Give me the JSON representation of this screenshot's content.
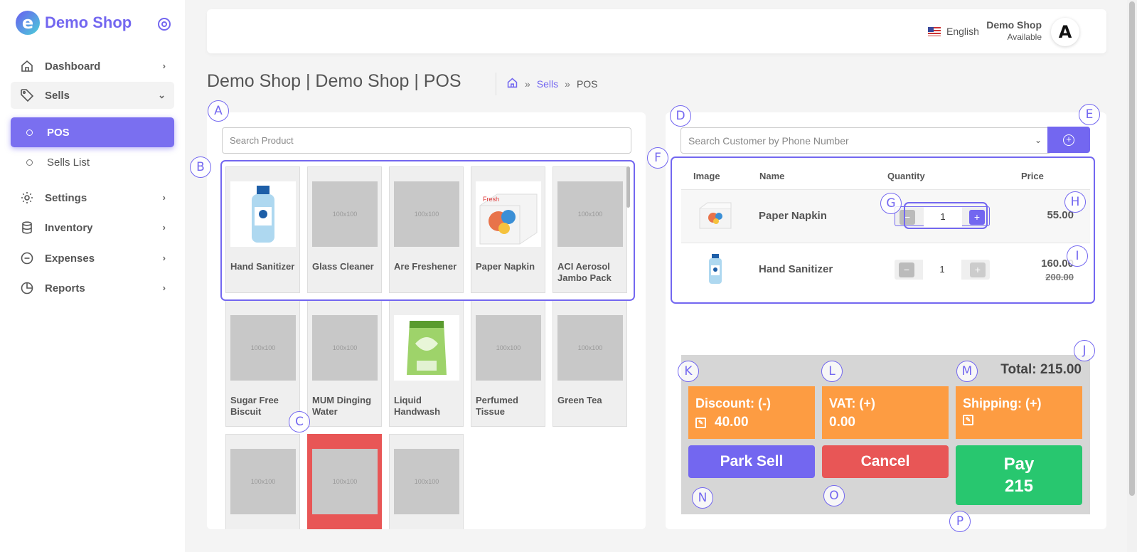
{
  "brand": {
    "name": "Demo Shop",
    "logo_letter": "e"
  },
  "sidebar": {
    "items": [
      {
        "label": "Dashboard",
        "icon": "home-icon"
      },
      {
        "label": "Sells",
        "icon": "tag-icon",
        "open": true,
        "children": [
          {
            "label": "POS",
            "active": true
          },
          {
            "label": "Sells List"
          }
        ]
      },
      {
        "label": "Settings",
        "icon": "gear-icon"
      },
      {
        "label": "Inventory",
        "icon": "database-icon"
      },
      {
        "label": "Expenses",
        "icon": "minus-circle-icon"
      },
      {
        "label": "Reports",
        "icon": "pie-chart-icon"
      }
    ]
  },
  "header": {
    "language": "English",
    "user_name": "Demo Shop",
    "user_status": "Available",
    "avatar_letter": "A"
  },
  "page": {
    "title": "Demo Shop | Demo Shop | POS",
    "breadcrumb": {
      "sep": "»",
      "link": "Sells",
      "current": "POS"
    }
  },
  "products": {
    "search_placeholder": "Search Product",
    "placeholder_thumb": "100x100",
    "items": [
      {
        "name": "Hand Sanitizer",
        "image": "hand-sanitizer"
      },
      {
        "name": "Glass Cleaner"
      },
      {
        "name": "Are Freshener"
      },
      {
        "name": "Paper Napkin",
        "image": "paper-napkin"
      },
      {
        "name": "ACI Aerosol Jambo Pack"
      },
      {
        "name": "Sugar Free Biscuit"
      },
      {
        "name": "MUM Dinging Water"
      },
      {
        "name": "Liquid Handwash",
        "image": "liquid-handwash"
      },
      {
        "name": "Perfumed Tissue"
      },
      {
        "name": "Green Tea"
      },
      {
        "name": ""
      },
      {
        "name": "",
        "highlight": true
      },
      {
        "name": ""
      }
    ]
  },
  "cart": {
    "customer_placeholder": "Search Customer by Phone Number",
    "columns": [
      "Image",
      "Name",
      "Quantity",
      "Price"
    ],
    "rows": [
      {
        "name": "Paper Napkin",
        "qty": "1",
        "price": "55.00"
      },
      {
        "name": "Hand Sanitizer",
        "qty": "1",
        "price": "160.00",
        "old_price": "200.00"
      }
    ],
    "total_label": "Total:",
    "total": "215.00",
    "discount": {
      "label": "Discount: (-)",
      "value": "40.00"
    },
    "vat": {
      "label": "VAT: (+)",
      "value": "0.00"
    },
    "shipping": {
      "label": "Shipping: (+)",
      "value": ""
    },
    "buttons": {
      "park": "Park Sell",
      "cancel": "Cancel",
      "pay": "Pay",
      "pay_amount": "215"
    }
  },
  "annotations": [
    "A",
    "B",
    "C",
    "D",
    "E",
    "F",
    "G",
    "H",
    "I",
    "J",
    "K",
    "L",
    "M",
    "N",
    "O",
    "P"
  ],
  "colors": {
    "accent": "#7367f0",
    "orange": "#fd9c42",
    "red": "#e85656",
    "green": "#28c76f"
  }
}
